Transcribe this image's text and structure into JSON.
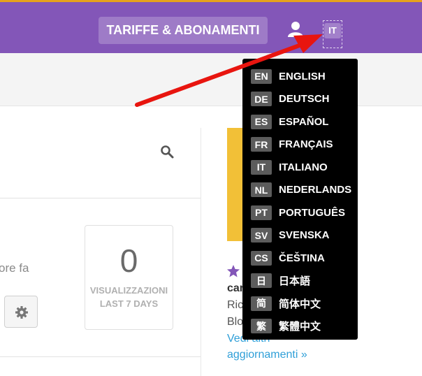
{
  "header": {
    "tariff_button": "TARIFFE & ABONAMENTI",
    "lang_current": "IT",
    "user_icon": "user-icon"
  },
  "colors": {
    "header_bg": "#8356b8",
    "accent_top": "#e6a21c",
    "menu_bg": "#000000",
    "badge_bg": "#5c5c5c",
    "promo_yellow": "#f2c037",
    "link_blue": "#2f9fd8",
    "arrow_red": "#e8150f"
  },
  "left_panel": {
    "time_text": "ore fa",
    "settings_icon": "gear-icon",
    "search_icon": "search-icon",
    "stat": {
      "value": "0",
      "label_line1": "VISUALIZZAZIONI",
      "label_line2": "LAST 7 DAYS"
    }
  },
  "right_panel": {
    "star_icon": "star-icon",
    "title_partial": "car",
    "line1_partial": "Ric",
    "line2_partial": "Blo",
    "link_line1": "Vedi altri",
    "link_line2": "aggiornamenti »"
  },
  "language_menu": [
    {
      "code": "EN",
      "name": "ENGLISH"
    },
    {
      "code": "DE",
      "name": "DEUTSCH"
    },
    {
      "code": "ES",
      "name": "ESPAÑOL"
    },
    {
      "code": "FR",
      "name": "FRANÇAIS"
    },
    {
      "code": "IT",
      "name": "ITALIANO"
    },
    {
      "code": "NL",
      "name": "NEDERLANDS"
    },
    {
      "code": "PT",
      "name": "PORTUGUÊS"
    },
    {
      "code": "SV",
      "name": "SVENSKA"
    },
    {
      "code": "CS",
      "name": "ČEŠTINA"
    },
    {
      "code": "日",
      "name": "日本語"
    },
    {
      "code": "简",
      "name": "简体中文"
    },
    {
      "code": "繁",
      "name": "繁體中文"
    }
  ]
}
